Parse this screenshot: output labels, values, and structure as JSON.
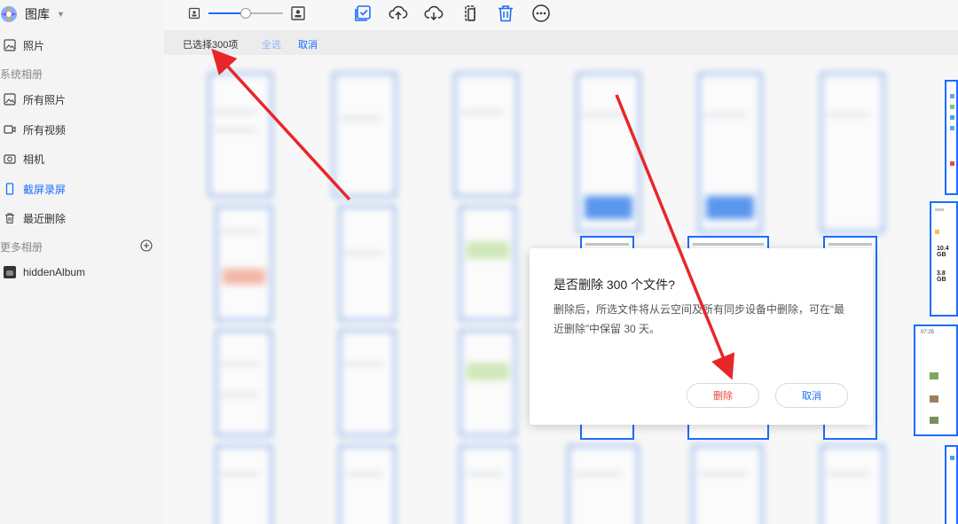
{
  "app": {
    "title": "图库"
  },
  "sidebar": {
    "photos_label": "照片",
    "system_albums_label": "系统相册",
    "items": [
      {
        "label": "所有照片",
        "icon": "image-icon"
      },
      {
        "label": "所有视频",
        "icon": "video-icon"
      },
      {
        "label": "相机",
        "icon": "camera-icon"
      },
      {
        "label": "截屏录屏",
        "icon": "phone-icon"
      },
      {
        "label": "最近删除",
        "icon": "trash-icon"
      }
    ],
    "more_albums_label": "更多相册",
    "album": "hiddenAlbum"
  },
  "toolbar": {
    "zoom_level": 0.5,
    "icons": [
      "small-thumbnail-icon",
      "large-thumbnail-icon",
      "select-all-icon",
      "upload-icon",
      "download-icon",
      "export-icon",
      "delete-icon",
      "more-icon"
    ]
  },
  "selection": {
    "count_text": "已选择300项",
    "select_all": "全选",
    "cancel": "取消"
  },
  "dialog": {
    "title": "是否删除 300 个文件?",
    "message": "删除后，所选文件将从云空间及所有同步设备中删除，可在“最近删除”中保留 30 天。",
    "delete_label": "删除",
    "cancel_label": "取消"
  },
  "thumb_text": {
    "storage_value": "10.4 GB",
    "storage_value2": "3.8 GB",
    "time_label": "07:25"
  },
  "colors": {
    "accent": "#1a6dff",
    "danger": "#e8453c",
    "annotation": "#e8262a"
  }
}
